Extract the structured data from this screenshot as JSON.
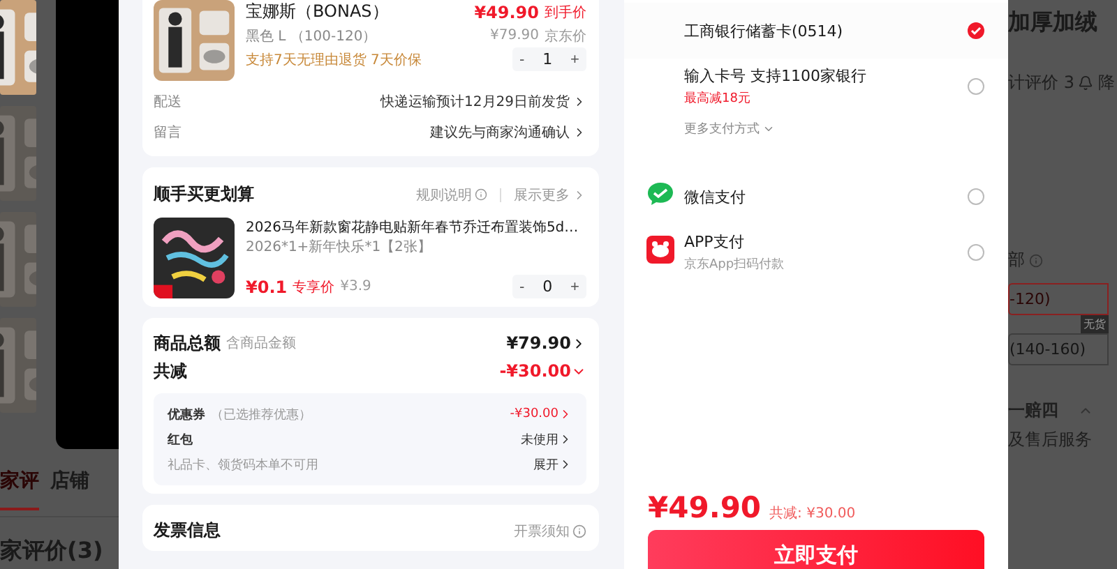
{
  "background_page": {
    "left": {
      "tabs": [
        {
          "label": "家评",
          "selected": true
        },
        {
          "label": "店铺",
          "selected": false
        }
      ],
      "section_title": "家评价(3)"
    },
    "right": {
      "title": "加厚加绒",
      "rating": "计评价 3",
      "price_alert": "降",
      "note": "部",
      "sizes": [
        {
          "label": "-120)",
          "selected": true
        },
        {
          "label": "(140-160)",
          "selected": false,
          "badge": "无货"
        }
      ],
      "guarantee": "一赔四",
      "service": "及售后服务"
    }
  },
  "checkout": {
    "order_item": {
      "title": "宝娜斯（BONAS）",
      "final_price": "¥49.90",
      "final_label": "到手价",
      "variant": "黑色  L （100-120）",
      "jd_price": "¥79.90",
      "jd_label": "京东价",
      "promises": "支持7天无理由退货  7天价保",
      "minus": "-",
      "quantity": "1",
      "plus": "+"
    },
    "rows": [
      {
        "label": "配送",
        "value": "快递运输预计12月29日前发货"
      },
      {
        "label": "留言",
        "value": "建议先与商家沟通确认"
      }
    ],
    "addon": {
      "title": "顺手买更划算",
      "rules": "规则说明",
      "more": "展示更多",
      "item": {
        "title": "2026马年新款窗花静电贴新年春节乔迁布置装饰5d…",
        "variant": "2026*1+新年快乐*1【2张】",
        "price": "¥0.1",
        "price_label": "专享价",
        "original": "¥3.9",
        "minus": "-",
        "quantity": "0",
        "plus": "+"
      }
    },
    "summary": {
      "total_label": "商品总额",
      "total_hint": "含商品金额",
      "total": "¥79.90",
      "discount_label": "共减",
      "discount": "-¥30.00",
      "discount_expanded": true,
      "details": [
        {
          "kind": "coupon",
          "label": "优惠券",
          "hint": "（已选推荐优惠）",
          "value": "-¥30.00"
        },
        {
          "kind": "plain",
          "label": "红包",
          "value": "未使用"
        },
        {
          "kind": "note",
          "label": "礼品卡、领货码本单不可用",
          "value": "展开"
        }
      ]
    },
    "invoice": {
      "title": "发票信息",
      "notice": "开票须知"
    }
  },
  "payment": {
    "methods": [
      {
        "name": "工商银行储蓄卡(0514)",
        "selected": true
      },
      {
        "name": "输入卡号 支持1100家银行",
        "promo": "最高减18元",
        "selected": false
      }
    ],
    "more_methods": "更多支付方式",
    "other_methods": [
      {
        "kind": "wechat",
        "name": "微信支付",
        "selected": false
      },
      {
        "kind": "app",
        "name": "APP支付",
        "hint": "京东App扫码付款",
        "selected": false
      }
    ],
    "footer": {
      "price": "¥49.90",
      "saving": "共减: ¥30.00",
      "pay_button": "立即支付"
    }
  }
}
